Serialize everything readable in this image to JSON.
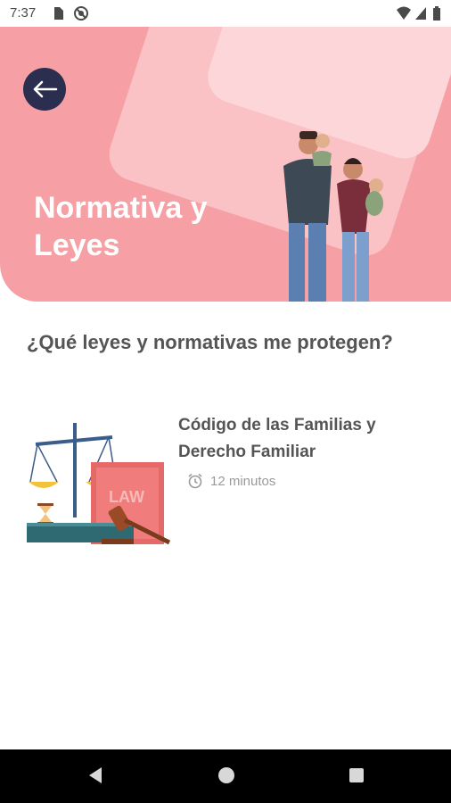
{
  "status_bar": {
    "time": "7:37",
    "icons": [
      "sim-card-icon",
      "no-disturb-icon",
      "wifi-icon",
      "signal-icon",
      "battery-icon"
    ]
  },
  "hero": {
    "title": "Normativa y Leyes",
    "back_icon": "arrow-left-icon",
    "colors": {
      "background": "#f6a0a5",
      "accent": "#2b2e4f"
    }
  },
  "section": {
    "title": "¿Qué leyes y normativas me protegen?"
  },
  "articles": [
    {
      "title": "Código de las Familias y Derecho Familiar",
      "duration": "12 minutos",
      "image_text": "LAW",
      "icon": "alarm-clock-icon"
    }
  ],
  "nav_bar": {
    "buttons": [
      "back-triangle-icon",
      "home-circle-icon",
      "recents-square-icon"
    ]
  }
}
